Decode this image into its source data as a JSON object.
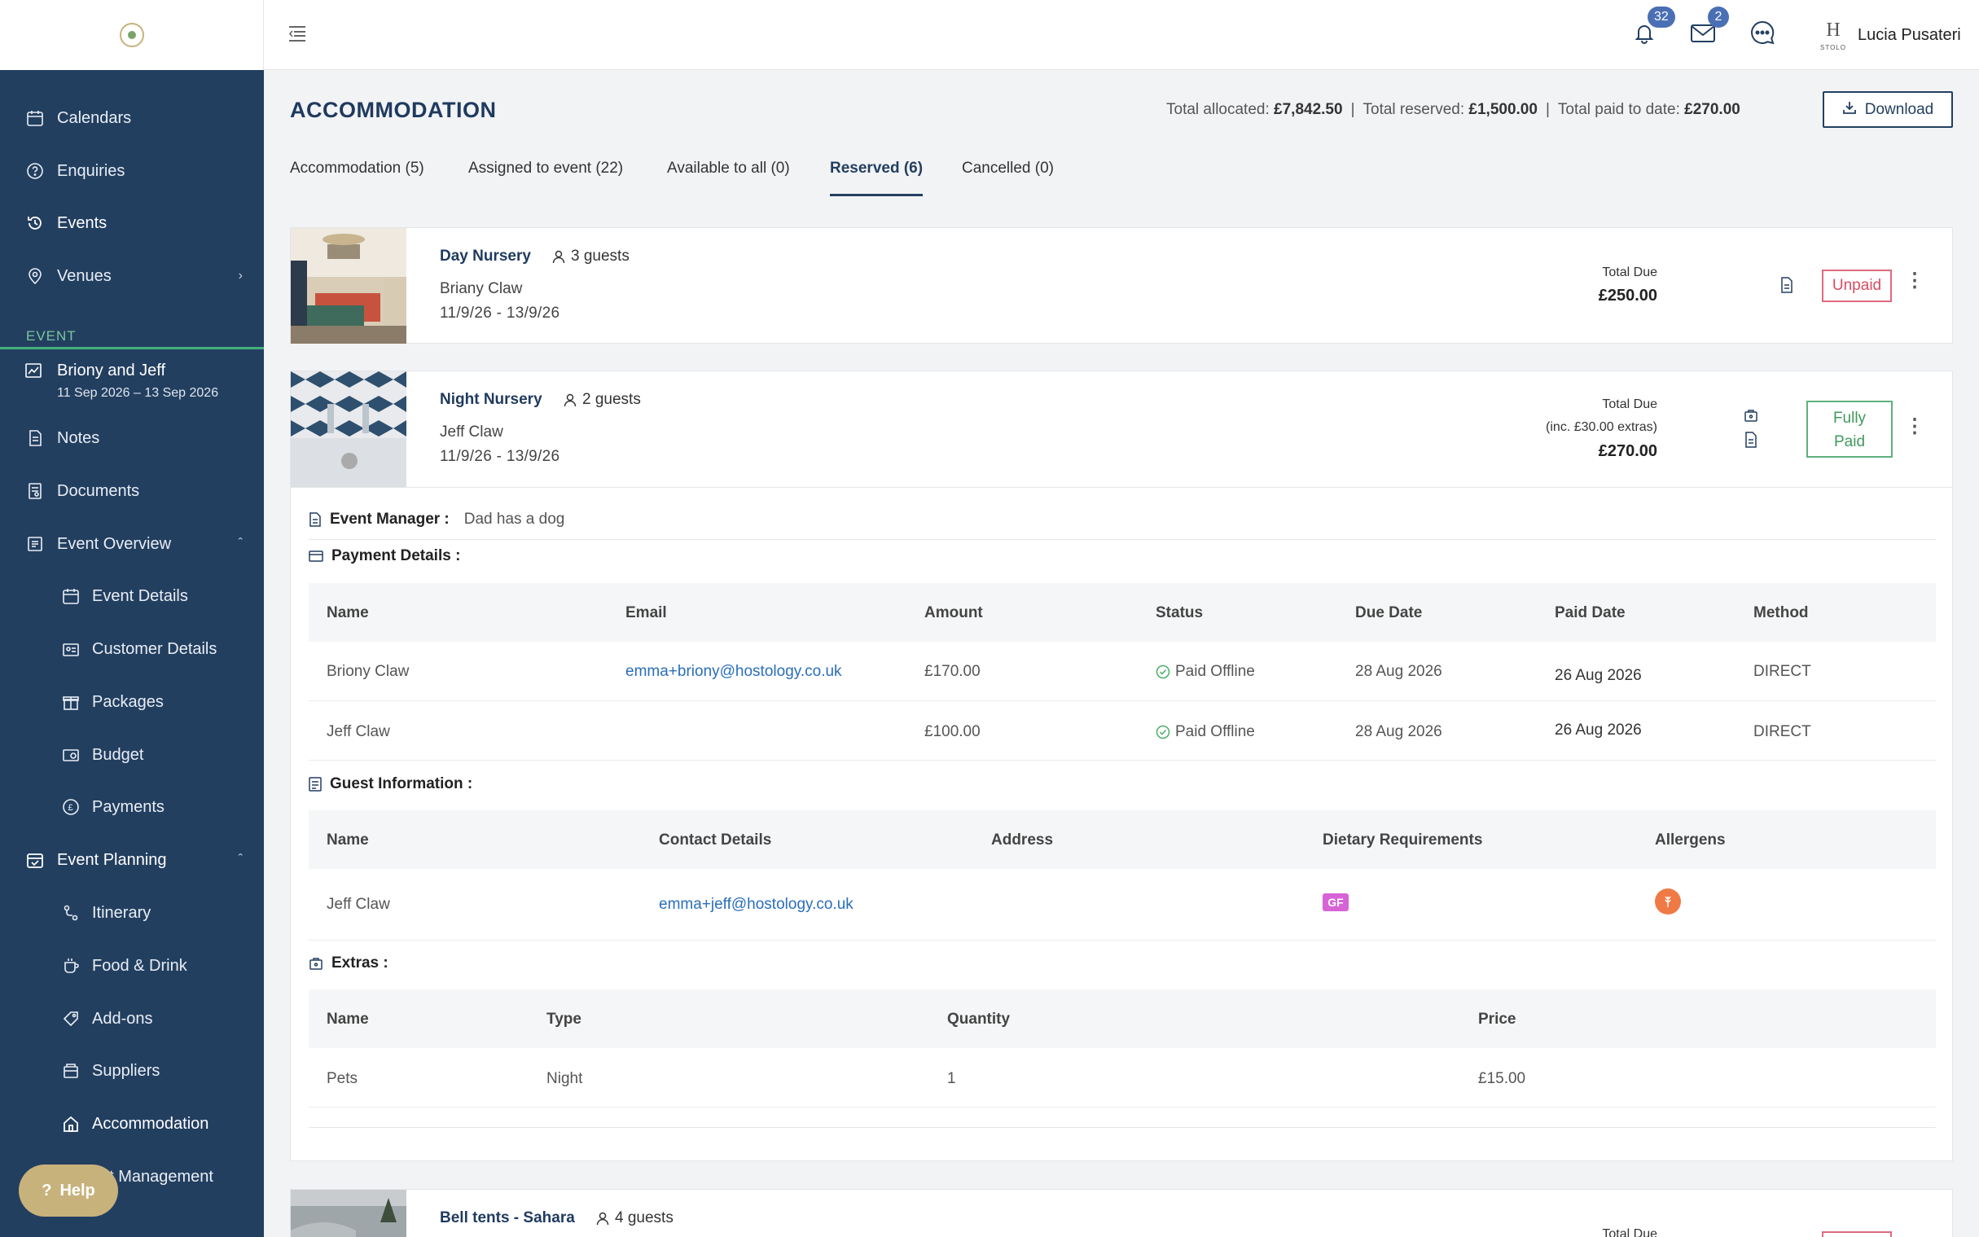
{
  "sidebar": {
    "items": [
      {
        "label": "Calendars",
        "icon": "calendar-icon"
      },
      {
        "label": "Enquiries",
        "icon": "question-circle-icon"
      },
      {
        "label": "Events",
        "icon": "history-icon"
      },
      {
        "label": "Venues",
        "icon": "location-pin-icon"
      }
    ],
    "event_section_label": "EVENT",
    "event": {
      "name": "Briony and Jeff",
      "dates": "11 Sep 2026 – 13 Sep 2026"
    },
    "event_items": [
      {
        "label": "Notes"
      },
      {
        "label": "Documents"
      },
      {
        "label": "Event Overview"
      },
      {
        "label": "Event Details"
      },
      {
        "label": "Customer Details"
      },
      {
        "label": "Packages"
      },
      {
        "label": "Budget"
      },
      {
        "label": "Payments"
      },
      {
        "label": "Event Planning"
      },
      {
        "label": "Itinerary"
      },
      {
        "label": "Food & Drink"
      },
      {
        "label": "Add-ons"
      },
      {
        "label": "Suppliers"
      },
      {
        "label": "Accommodation"
      },
      {
        "label": "est Management"
      }
    ],
    "help_label": "Help"
  },
  "topbar": {
    "notifications_count": "32",
    "messages_count": "2",
    "brand_letter": "H",
    "brand_small": "STOLO",
    "user_name": "Lucia Pusateri"
  },
  "page": {
    "title": "ACCOMMODATION",
    "totals": {
      "allocated_label": "Total allocated:",
      "allocated_value": "£7,842.50",
      "reserved_label": "Total reserved:",
      "reserved_value": "£1,500.00",
      "paid_label": "Total paid to date:",
      "paid_value": "£270.00",
      "separator": "|"
    },
    "download_label": "Download"
  },
  "tabs": [
    {
      "label": "Accommodation  (5)"
    },
    {
      "label": "Assigned to event  (22)"
    },
    {
      "label": "Available to all  (0)"
    },
    {
      "label": "Reserved  (6)"
    },
    {
      "label": "Cancelled  (0)"
    }
  ],
  "rooms": [
    {
      "title": "Day Nursery",
      "guests": "3 guests",
      "guest_name": "Briany Claw",
      "dates": "11/9/26 - 13/9/26",
      "total_due_label": "Total Due",
      "total_due": "£250.00",
      "status": "Unpaid"
    },
    {
      "title": "Night Nursery",
      "guests": "2 guests",
      "guest_name": "Jeff Claw",
      "dates": "11/9/26 - 13/9/26",
      "total_due_label": "Total Due",
      "extras_note": "(inc. £30.00 extras)",
      "total_due": "£270.00",
      "status_line1": "Fully",
      "status_line2": "Paid",
      "event_manager_label": "Event Manager :",
      "event_manager_note": "Dad has a dog",
      "payment_details_label": "Payment Details :",
      "payment_headers": [
        "Name",
        "Email",
        "Amount",
        "Status",
        "Due Date",
        "Paid Date",
        "Method"
      ],
      "payments": [
        {
          "name": "Briony Claw",
          "email": "emma+briony@hostology.co.uk",
          "amount": "£170.00",
          "status": "Paid Offline",
          "due": "28 Aug 2026",
          "paid": "26 Aug 2026",
          "method": "DIRECT"
        },
        {
          "name": "Jeff Claw",
          "email": "",
          "amount": "£100.00",
          "status": "Paid Offline",
          "due": "28 Aug 2026",
          "paid": "26 Aug 2026",
          "method": "DIRECT"
        }
      ],
      "guest_info_label": "Guest Information :",
      "guest_headers": [
        "Name",
        "Contact Details",
        "Address",
        "Dietary Requirements",
        "Allergens"
      ],
      "guest_rows": [
        {
          "name": "Jeff Claw",
          "contact": "emma+jeff@hostology.co.uk",
          "address": "",
          "dietary": "GF"
        }
      ],
      "extras_label": "Extras :",
      "extras_headers": [
        "Name",
        "Type",
        "Quantity",
        "Price"
      ],
      "extras": [
        {
          "name": "Pets",
          "type": "Night",
          "quantity": "1",
          "price": "£15.00"
        }
      ]
    },
    {
      "title": "Bell tents - Sahara",
      "guests": "4 guests",
      "total_due_label": "Total Due"
    }
  ],
  "colors": {
    "sidebar": "#233f60",
    "accent_green": "#3fb07a",
    "unpaid": "#d84b62",
    "paid": "#3f9a5c",
    "link": "#2a6ebc",
    "brand_gold": "#c8b27c"
  }
}
